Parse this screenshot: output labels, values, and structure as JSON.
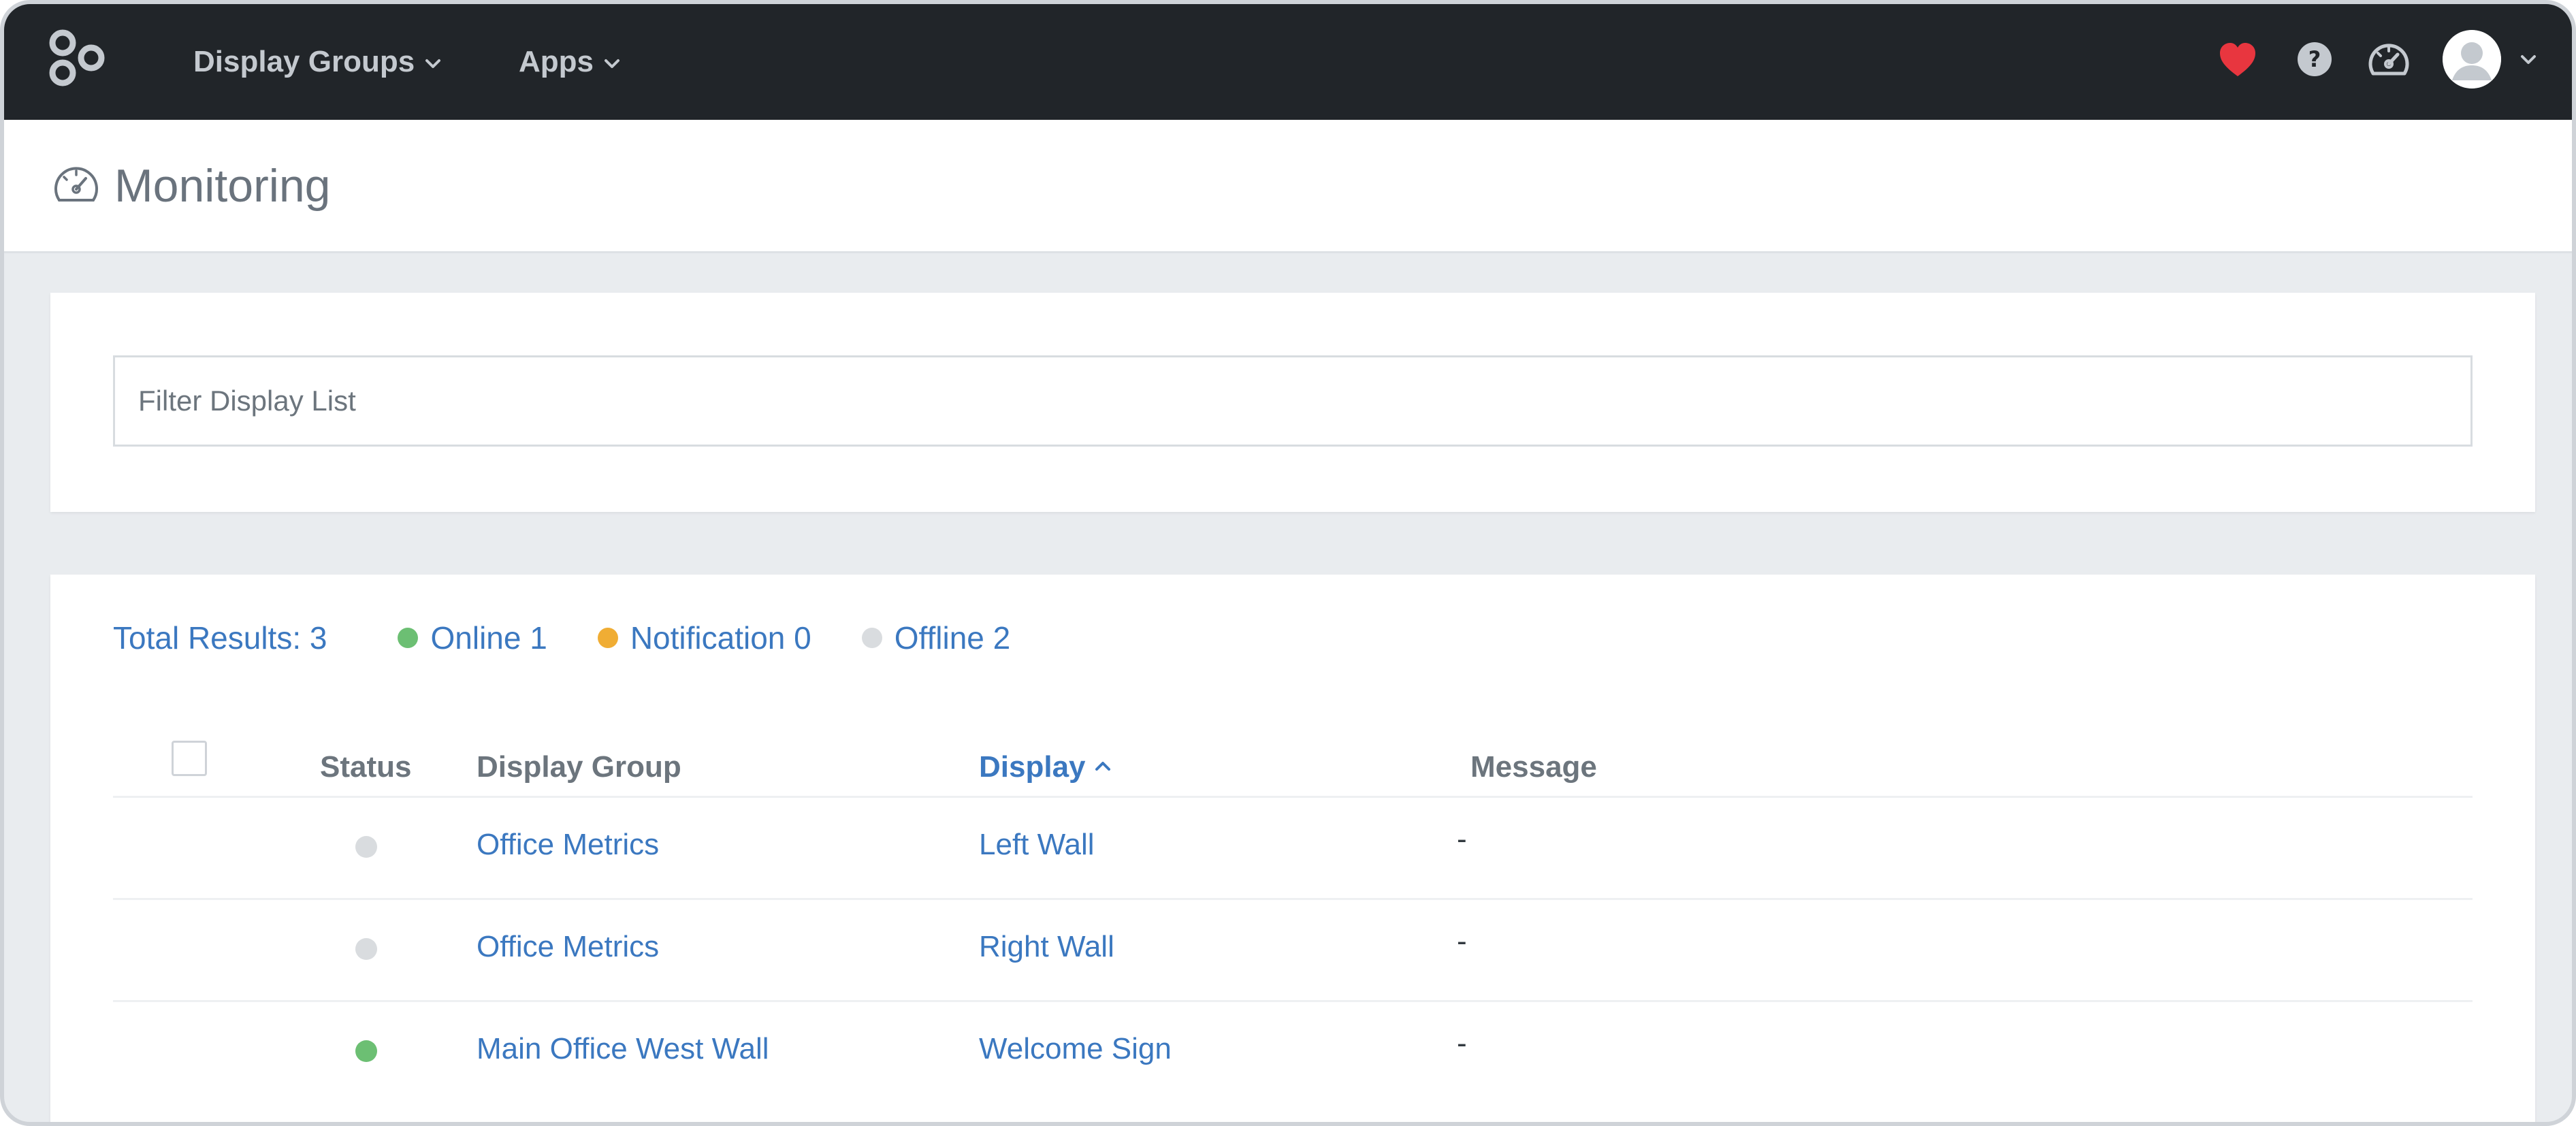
{
  "nav": {
    "display_groups": "Display Groups",
    "apps": "Apps",
    "icons": {
      "logo": "app-logo-icon",
      "heart": "heart-icon",
      "help": "help-icon",
      "monitor": "gauge-icon",
      "user": "avatar-icon"
    }
  },
  "page": {
    "title": "Monitoring",
    "title_icon": "gauge-icon"
  },
  "filter": {
    "placeholder": "Filter Display List",
    "value": ""
  },
  "summary": {
    "total_label": "Total Results: 3",
    "online_label": "Online 1",
    "notification_label": "Notification 0",
    "offline_label": "Offline 2"
  },
  "table": {
    "columns": {
      "status": "Status",
      "display_group": "Display Group",
      "display": "Display",
      "message": "Message"
    },
    "sorted_by": "display",
    "sort_direction": "ascending",
    "rows": [
      {
        "status": "offline",
        "display_group": "Office Metrics",
        "display": "Left Wall",
        "message": "-"
      },
      {
        "status": "offline",
        "display_group": "Office Metrics",
        "display": "Right Wall",
        "message": "-"
      },
      {
        "status": "online",
        "display_group": "Main Office West Wall",
        "display": "Welcome Sign",
        "message": "-"
      }
    ]
  },
  "colors": {
    "navbar_bg": "#212529",
    "link": "#3b78c0",
    "online": "#6cbf73",
    "notification": "#f0ad34",
    "offline": "#d9dcdf",
    "heart": "#e8363f"
  }
}
